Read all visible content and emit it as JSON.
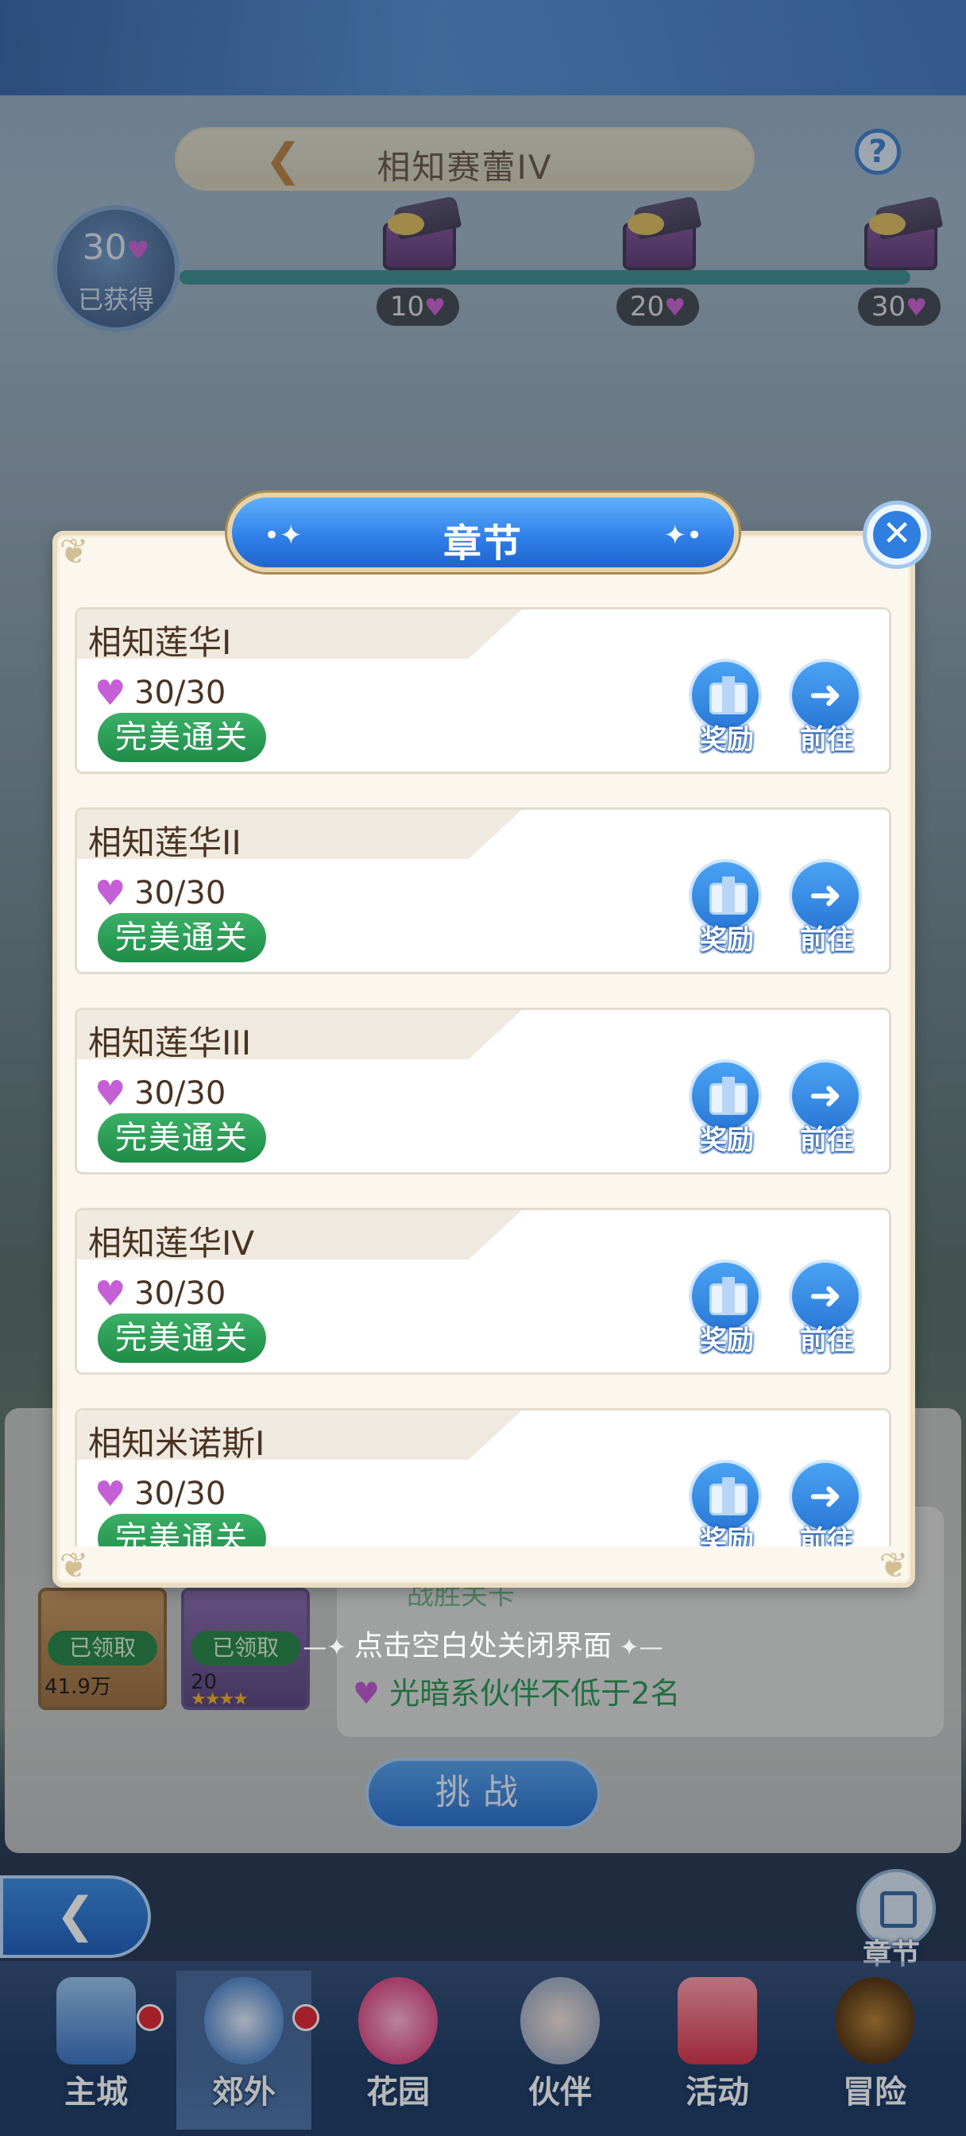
{
  "header": {
    "title": "相知赛蕾IV",
    "help_label": "?"
  },
  "progress": {
    "earned_value": "30",
    "earned_label": "已获得",
    "milestones": [
      {
        "value": "10"
      },
      {
        "value": "20"
      },
      {
        "value": "30"
      }
    ],
    "fill_fraction": 1.0
  },
  "background_panel": {
    "condition_1": "战胜关卡",
    "condition_2": "光暗系伙伴不低于2名",
    "claimed_label": "已领取",
    "card_1_value": "41.9万",
    "card_2_value": "20",
    "challenge_label": "挑战"
  },
  "close_hint": "点击空白处关闭界面",
  "modal": {
    "title": "章节",
    "chapters": [
      {
        "name": "相知莲华I",
        "score": "30/30",
        "status": "完美通关",
        "reward_label": "奖励",
        "go_label": "前往"
      },
      {
        "name": "相知莲华II",
        "score": "30/30",
        "status": "完美通关",
        "reward_label": "奖励",
        "go_label": "前往"
      },
      {
        "name": "相知莲华III",
        "score": "30/30",
        "status": "完美通关",
        "reward_label": "奖励",
        "go_label": "前往"
      },
      {
        "name": "相知莲华IV",
        "score": "30/30",
        "status": "完美通关",
        "reward_label": "奖励",
        "go_label": "前往"
      },
      {
        "name": "相知米诺斯I",
        "score": "30/30",
        "status": "完美通关",
        "reward_label": "奖励",
        "go_label": "前往"
      }
    ]
  },
  "side": {
    "chapter_label": "章节"
  },
  "nav": {
    "items": [
      {
        "label": "主城"
      },
      {
        "label": "郊外"
      },
      {
        "label": "花园"
      },
      {
        "label": "伙伴"
      },
      {
        "label": "活动"
      },
      {
        "label": "冒险"
      }
    ]
  },
  "colors": {
    "accent_blue": "#2e7de6",
    "status_green": "#1f8c48",
    "heart_purple": "#c45fd6"
  }
}
